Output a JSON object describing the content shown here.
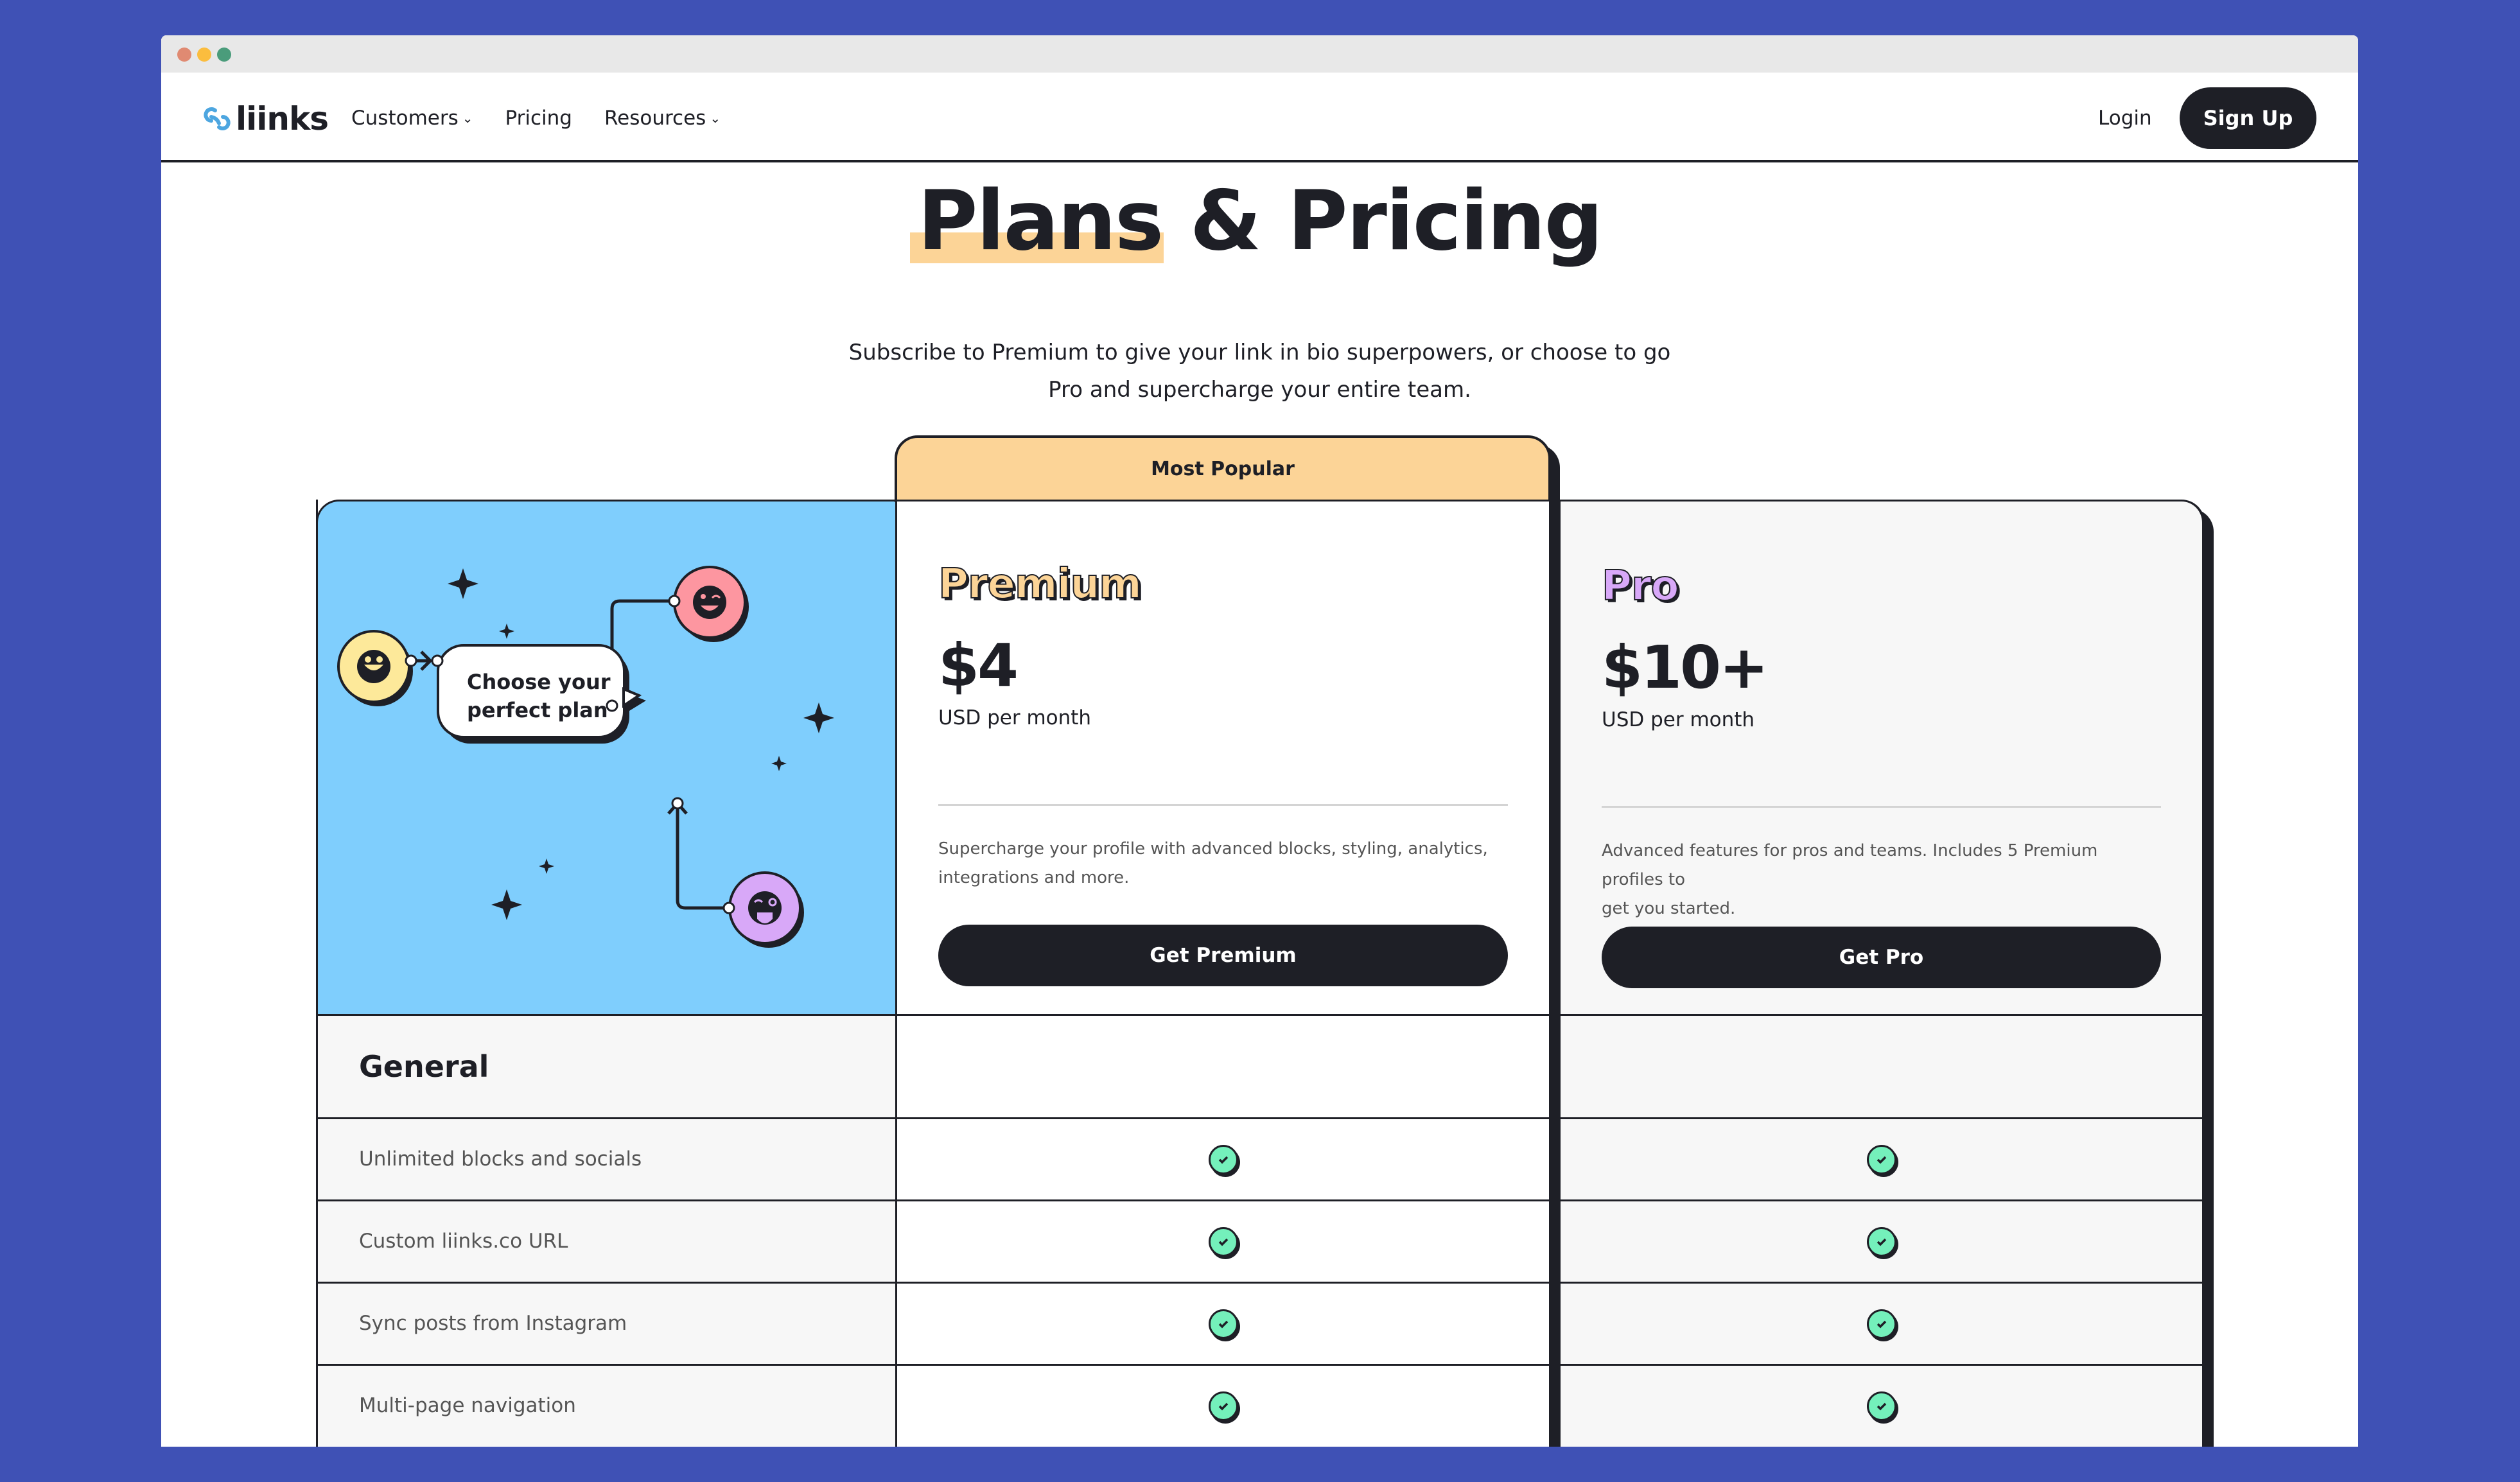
{
  "browser": {
    "controls": [
      "close",
      "minimize",
      "maximize"
    ]
  },
  "nav": {
    "logo_text": "liinks",
    "links": [
      {
        "label": "Customers",
        "has_dropdown": true
      },
      {
        "label": "Pricing",
        "has_dropdown": false
      },
      {
        "label": "Resources",
        "has_dropdown": true
      }
    ],
    "login_label": "Login",
    "signup_label": "Sign Up"
  },
  "hero": {
    "title_highlight": "Plans",
    "title_rest": "& Pricing",
    "subtitle_line1": "Subscribe to Premium to give your link in bio superpowers, or choose to go",
    "subtitle_line2": "Pro and supercharge your entire team."
  },
  "illustration": {
    "bubble_line1": "Choose your",
    "bubble_line2": "perfect plan",
    "emojis": [
      "heart-eyes-smile",
      "wink-smile",
      "tongue-wink"
    ]
  },
  "plans": [
    {
      "badge": "Most Popular",
      "name": "Premium",
      "price": "$4",
      "period": "USD per month",
      "description_line1": "Supercharge your profile with advanced blocks, styling, analytics,",
      "description_line2": "integrations and more.",
      "cta": "Get Premium",
      "accent": "#fcd497"
    },
    {
      "name": "Pro",
      "price": "$10+",
      "period": "USD per month",
      "description_line1": "Advanced features for pros and teams. Includes 5 Premium profiles to",
      "description_line2": "get you started.",
      "cta": "Get Pro",
      "accent": "#d8a8f8"
    }
  ],
  "features": {
    "section": "General",
    "rows": [
      {
        "label": "Unlimited blocks and socials",
        "premium": true,
        "pro": true
      },
      {
        "label": "Custom liinks.co URL",
        "premium": true,
        "pro": true
      },
      {
        "label": "Sync posts from Instagram",
        "premium": true,
        "pro": true
      },
      {
        "label": "Multi-page navigation",
        "premium": true,
        "pro": true
      }
    ]
  },
  "colors": {
    "background": "#3f51b5",
    "ink": "#1e1f26",
    "sky": "#7fcefd",
    "check": "#74f0bb",
    "premium": "#fcd497",
    "pro": "#d8a8f8"
  },
  "chat_widget": {
    "icon": "chat-bubble-icon"
  }
}
